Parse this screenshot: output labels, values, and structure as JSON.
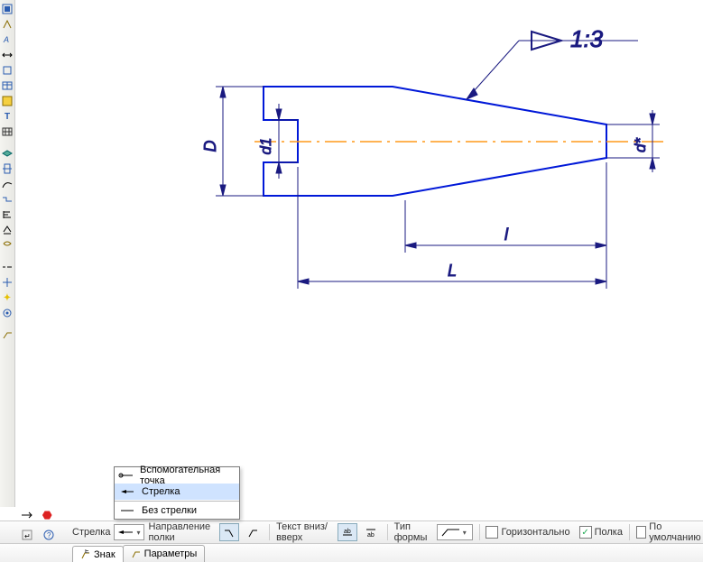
{
  "drawing": {
    "taper_ratio": "1:3",
    "dim_D": "D",
    "dim_d1": "d1",
    "dim_dstar": "d*",
    "dim_l_small": "l",
    "dim_L_big": "L"
  },
  "dropdown": {
    "items": [
      {
        "label": "Вспомогательная точка",
        "icon": "aux-point"
      },
      {
        "label": "Стрелка",
        "icon": "arrow",
        "selected": true
      },
      {
        "label": "Без стрелки",
        "icon": "no-arrow"
      }
    ]
  },
  "props": {
    "arrow_label": "Стрелка",
    "shelf_dir_label": "Направление полки",
    "text_dir_label": "Текст вниз/вверх",
    "shape_type_label": "Тип формы",
    "horiz_label": "Горизонтально",
    "shelf_label": "Полка",
    "default_label": "По умолчанию",
    "shelf_checked": true,
    "horiz_checked": false,
    "default_checked": false
  },
  "tabs": {
    "sign": "Знак",
    "params": "Параметры"
  },
  "toolbar_icons": [
    "wizard",
    "point",
    "segment",
    "text",
    "dim",
    "rough",
    "table",
    "hatch",
    "text2",
    "grid",
    "layers",
    "view",
    "curve",
    "break",
    "align",
    "arc",
    "spline",
    "dash",
    "center",
    "marker",
    "param",
    "leader"
  ]
}
